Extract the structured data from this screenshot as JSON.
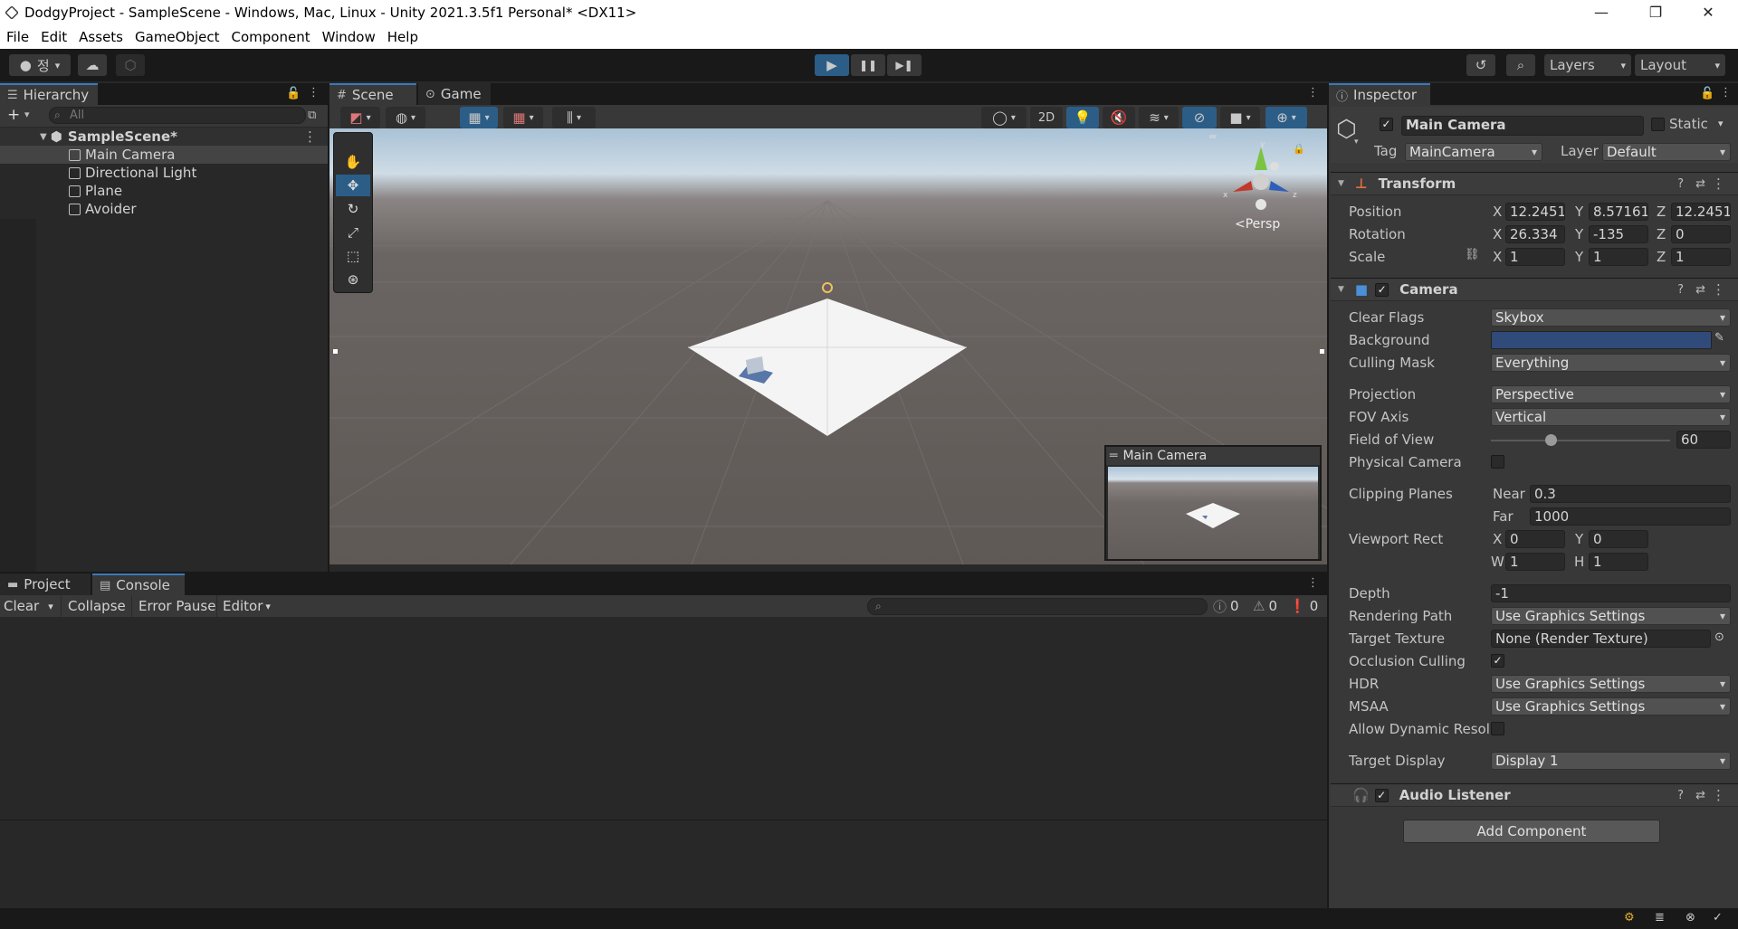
{
  "window": {
    "title": "DodgyProject - SampleScene - Windows, Mac, Linux - Unity 2021.3.5f1 Personal* <DX11>",
    "minimize": "—",
    "maximize": "❐",
    "close": "✕"
  },
  "menu": [
    "File",
    "Edit",
    "Assets",
    "GameObject",
    "Component",
    "Window",
    "Help"
  ],
  "toolbar": {
    "account": "정",
    "play": "▶",
    "pause": "❚❚",
    "step": "▶❚",
    "layers": "Layers",
    "layout": "Layout"
  },
  "hierarchy": {
    "tab": "Hierarchy",
    "search_placeholder": "All",
    "scene": "SampleScene*",
    "items": [
      "Main Camera",
      "Directional Light",
      "Plane",
      "Avoider"
    ]
  },
  "scene_view": {
    "tabs": [
      "Scene",
      "Game"
    ],
    "mode_2d": "2D",
    "persp": "Persp",
    "gizmo_axes": {
      "x": "x",
      "y": "y",
      "z": "z"
    },
    "camera_preview_title": "Main Camera"
  },
  "console": {
    "tabs": [
      "Project",
      "Console"
    ],
    "buttons": [
      "Clear",
      "Collapse",
      "Error Pause",
      "Editor"
    ],
    "counts": {
      "info": "0",
      "warn": "0",
      "error": "0"
    }
  },
  "inspector": {
    "tab": "Inspector",
    "object_name": "Main Camera",
    "static_label": "Static",
    "tag_label": "Tag",
    "tag_value": "MainCamera",
    "layer_label": "Layer",
    "layer_value": "Default",
    "transform": {
      "title": "Transform",
      "rows": [
        {
          "label": "Position",
          "x": "12.2451(",
          "y": "8.57161:",
          "z": "12.2451("
        },
        {
          "label": "Rotation",
          "x": "26.334",
          "y": "-135",
          "z": "0"
        },
        {
          "label": "Scale",
          "x": "1",
          "y": "1",
          "z": "1"
        }
      ]
    },
    "camera": {
      "title": "Camera",
      "clear_flags_label": "Clear Flags",
      "clear_flags": "Skybox",
      "background_label": "Background",
      "background_color": "#304a7a",
      "culling_mask_label": "Culling Mask",
      "culling_mask": "Everything",
      "projection_label": "Projection",
      "projection": "Perspective",
      "fov_axis_label": "FOV Axis",
      "fov_axis": "Vertical",
      "fov_label": "Field of View",
      "fov": "60",
      "physical_label": "Physical Camera",
      "clipping_label": "Clipping Planes",
      "near_label": "Near",
      "near": "0.3",
      "far_label": "Far",
      "far": "1000",
      "viewport_label": "Viewport Rect",
      "vx": "0",
      "vy": "0",
      "vw": "1",
      "vh": "1",
      "depth_label": "Depth",
      "depth": "-1",
      "render_path_label": "Rendering Path",
      "render_path": "Use Graphics Settings",
      "target_tex_label": "Target Texture",
      "target_tex": "None (Render Texture)",
      "occlusion_label": "Occlusion Culling",
      "hdr_label": "HDR",
      "hdr": "Use Graphics Settings",
      "msaa_label": "MSAA",
      "msaa": "Use Graphics Settings",
      "dyn_res_label": "Allow Dynamic Resol",
      "target_display_label": "Target Display",
      "target_display": "Display 1"
    },
    "audio_listener": "Audio Listener",
    "add_component": "Add Component"
  }
}
